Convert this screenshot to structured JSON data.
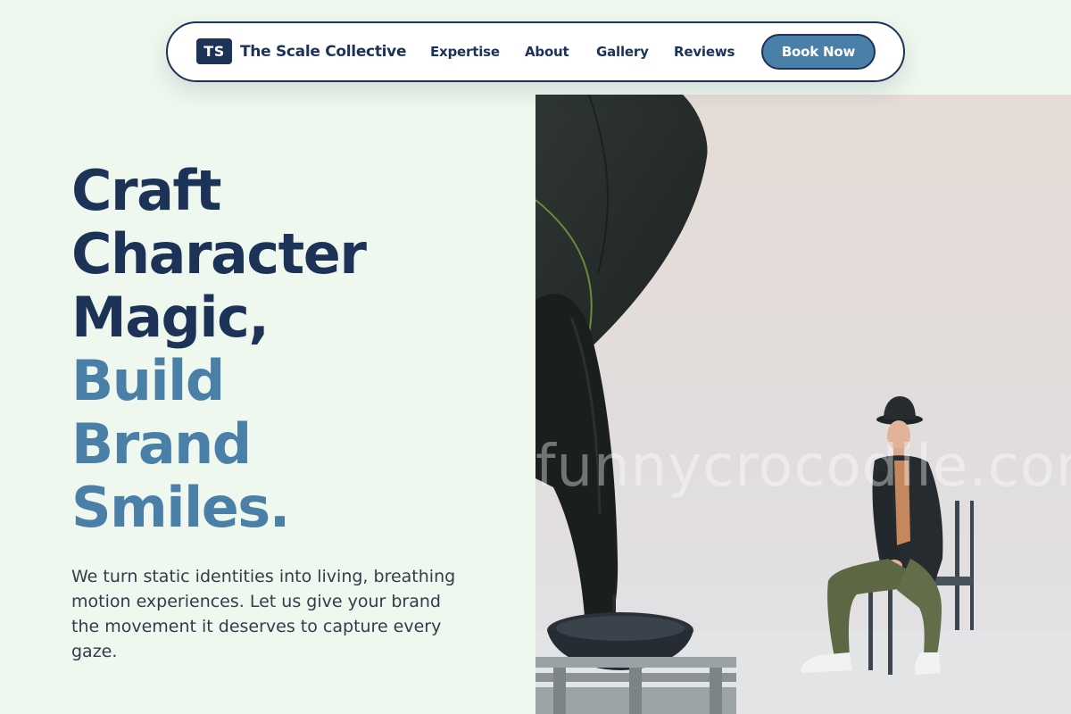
{
  "brand": {
    "mark": "TS",
    "name": "The Scale Collective"
  },
  "nav": {
    "links": [
      "Expertise",
      "About",
      "Gallery",
      "Reviews"
    ],
    "cta": "Book Now"
  },
  "hero": {
    "headline_dark": [
      "Craft",
      "Character",
      "Magic,"
    ],
    "headline_accent": [
      "Build",
      "Brand",
      "Smiles."
    ],
    "lead": "We turn static identities into living, breathing motion experiences. Let us give your brand the movement it deserves to capture every gaze.",
    "image_watermark": "funnycrocodile.com"
  },
  "colors": {
    "background": "#eff8ee",
    "navy": "#1c3357",
    "accent": "#4a7fa7",
    "body_text": "#323c4a"
  },
  "icons": {
    "brand_mark": "brand-logo-icon"
  }
}
